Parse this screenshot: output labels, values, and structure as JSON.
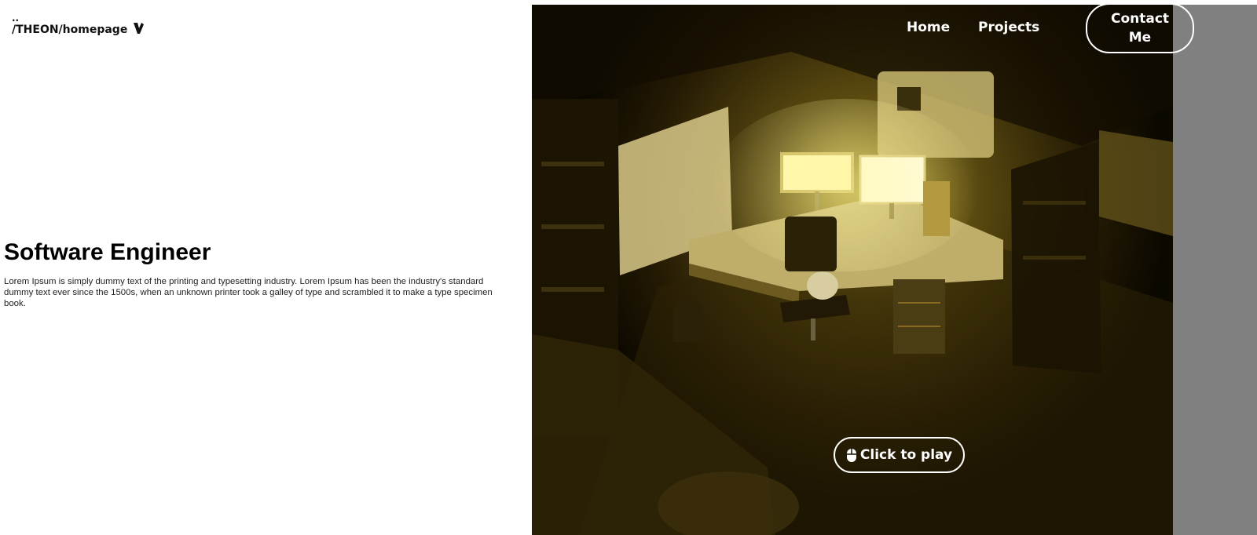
{
  "header": {
    "breadcrumb_dots": "..",
    "breadcrumb_path": "/THEON/homepage",
    "logo_icon": "typo3-icon"
  },
  "nav": {
    "home_label": "Home",
    "projects_label": "Projects",
    "contact_label": "Contact Me"
  },
  "hero": {
    "title": "Software Engineer",
    "body": "Lorem Ipsum is simply dummy text of the printing and typesetting industry. Lorem Ipsum has been the industry's standard dummy text ever since the 1500s, when an unknown printer took a galley of type and scrambled it to make a type specimen book."
  },
  "scene": {
    "play_label": "Click to play",
    "play_icon": "mouse-icon",
    "accent_color": "#e8d15a",
    "side_strip_color": "#808080"
  }
}
